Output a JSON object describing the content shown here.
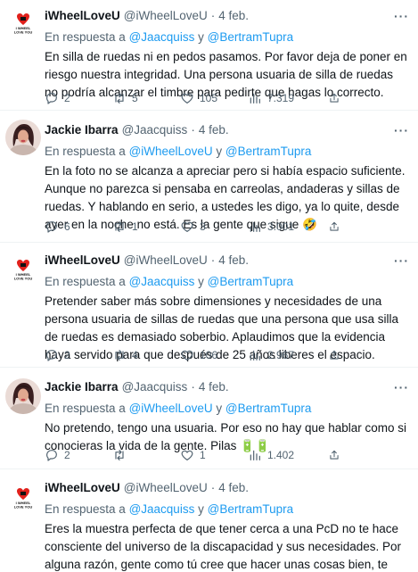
{
  "reply_prefix": "En respuesta a",
  "conjunction": "y",
  "dot": "·",
  "more": "···",
  "tweets": [
    {
      "name": "iWheelLoveU",
      "handle": "@iWheelLoveU",
      "time": "4 feb.",
      "mentions": [
        "@Jaacquiss",
        "@BertramTupra"
      ],
      "text": "En silla de ruedas ni en pedos pasamos. Por favor deja de poner en riesgo nuestra integridad. Una persona usuaria de silla de ruedas no podría alcanzar el timbre para pedirte que hagas lo correcto.",
      "replies": "2",
      "retweets": "5",
      "likes": "105",
      "views": "7.319"
    },
    {
      "name": "Jackie Ibarra",
      "handle": "@Jaacquiss",
      "time": "4 feb.",
      "mentions": [
        "@iWheelLoveU",
        "@BertramTupra"
      ],
      "text": "En la foto no se alcanza a apreciar pero si había espacio suficiente. Aunque no parezca si pensaba en carreolas, andaderas y sillas de ruedas. Y hablando en serio, a ustedes les digo, ya lo quite, desde ayer en la noche no está. Es la gente que sigue 🤣",
      "replies": "6",
      "retweets": "1",
      "likes": "3",
      "views": "3.001"
    },
    {
      "name": "iWheelLoveU",
      "handle": "@iWheelLoveU",
      "time": "4 feb.",
      "mentions": [
        "@Jaacquiss",
        "@BertramTupra"
      ],
      "text": "Pretender saber más sobre dimensiones y necesidades de una persona usuaria de sillas de ruedas que una persona que usa silla de ruedas es demasiado soberbio. Aplaudimos que la evidencia haya servido para que después de 25 años liberes el espacio.",
      "replies": "2",
      "retweets": "4",
      "likes": "106",
      "views": "2.967"
    },
    {
      "name": "Jackie Ibarra",
      "handle": "@Jaacquiss",
      "time": "4 feb.",
      "mentions": [
        "@iWheelLoveU",
        "@BertramTupra"
      ],
      "text": "No pretendo, tengo una usuaria. Por eso no hay que hablar como si conocieras la vida de la gente. Pilas 🔋🔋",
      "replies": "2",
      "retweets": "",
      "likes": "1",
      "views": "1.402"
    },
    {
      "name": "iWheelLoveU",
      "handle": "@iWheelLoveU",
      "time": "4 feb.",
      "mentions": [
        "@Jaacquiss",
        "@BertramTupra"
      ],
      "text": "Eres la muestra perfecta de que tener cerca a una PcD no te hace consciente del universo de la discapacidad y sus necesidades. Por alguna razón, gente como tú cree que hacer unas cosas bien, te permite hacer mal el resto."
    }
  ],
  "logo_text": "I WHEEL LOVE YOU",
  "colors": {
    "link": "#1d9bf0",
    "secondary": "#536471",
    "text": "#0f1419",
    "divider": "#eff3f4",
    "logo_red": "#e0201b"
  }
}
